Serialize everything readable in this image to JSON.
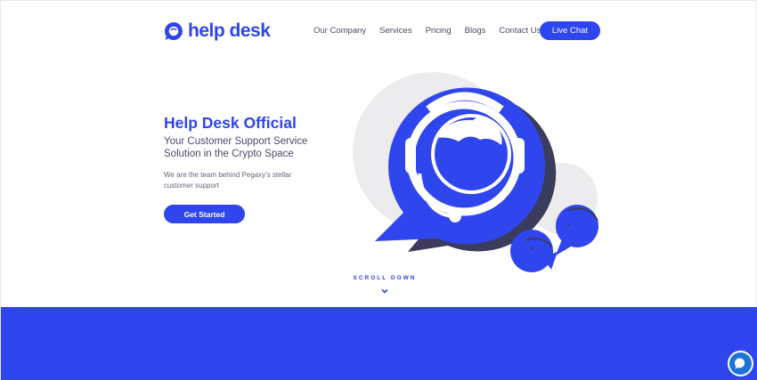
{
  "header": {
    "logo_text": "help desk",
    "nav": [
      "Our Company",
      "Services",
      "Pricing",
      "Blogs",
      "Contact Us"
    ],
    "cta_label": "Live Chat"
  },
  "hero": {
    "title": "Help Desk Official",
    "subtitle": "Your Customer Support Service Solution in the Crypto Space",
    "description": "We are the team behind Pegaxy's stellar customer support",
    "button_label": "Get Started"
  },
  "scroll": {
    "label": "SCROLL DOWN"
  },
  "colors": {
    "brand": "#2f45ee",
    "band": "#2f45ee",
    "chat_widget": "#1e73d8"
  },
  "icons": {
    "logo": "chat-bubble-icon",
    "scroll": "chevron-down-icon",
    "widget": "chat-icon"
  }
}
